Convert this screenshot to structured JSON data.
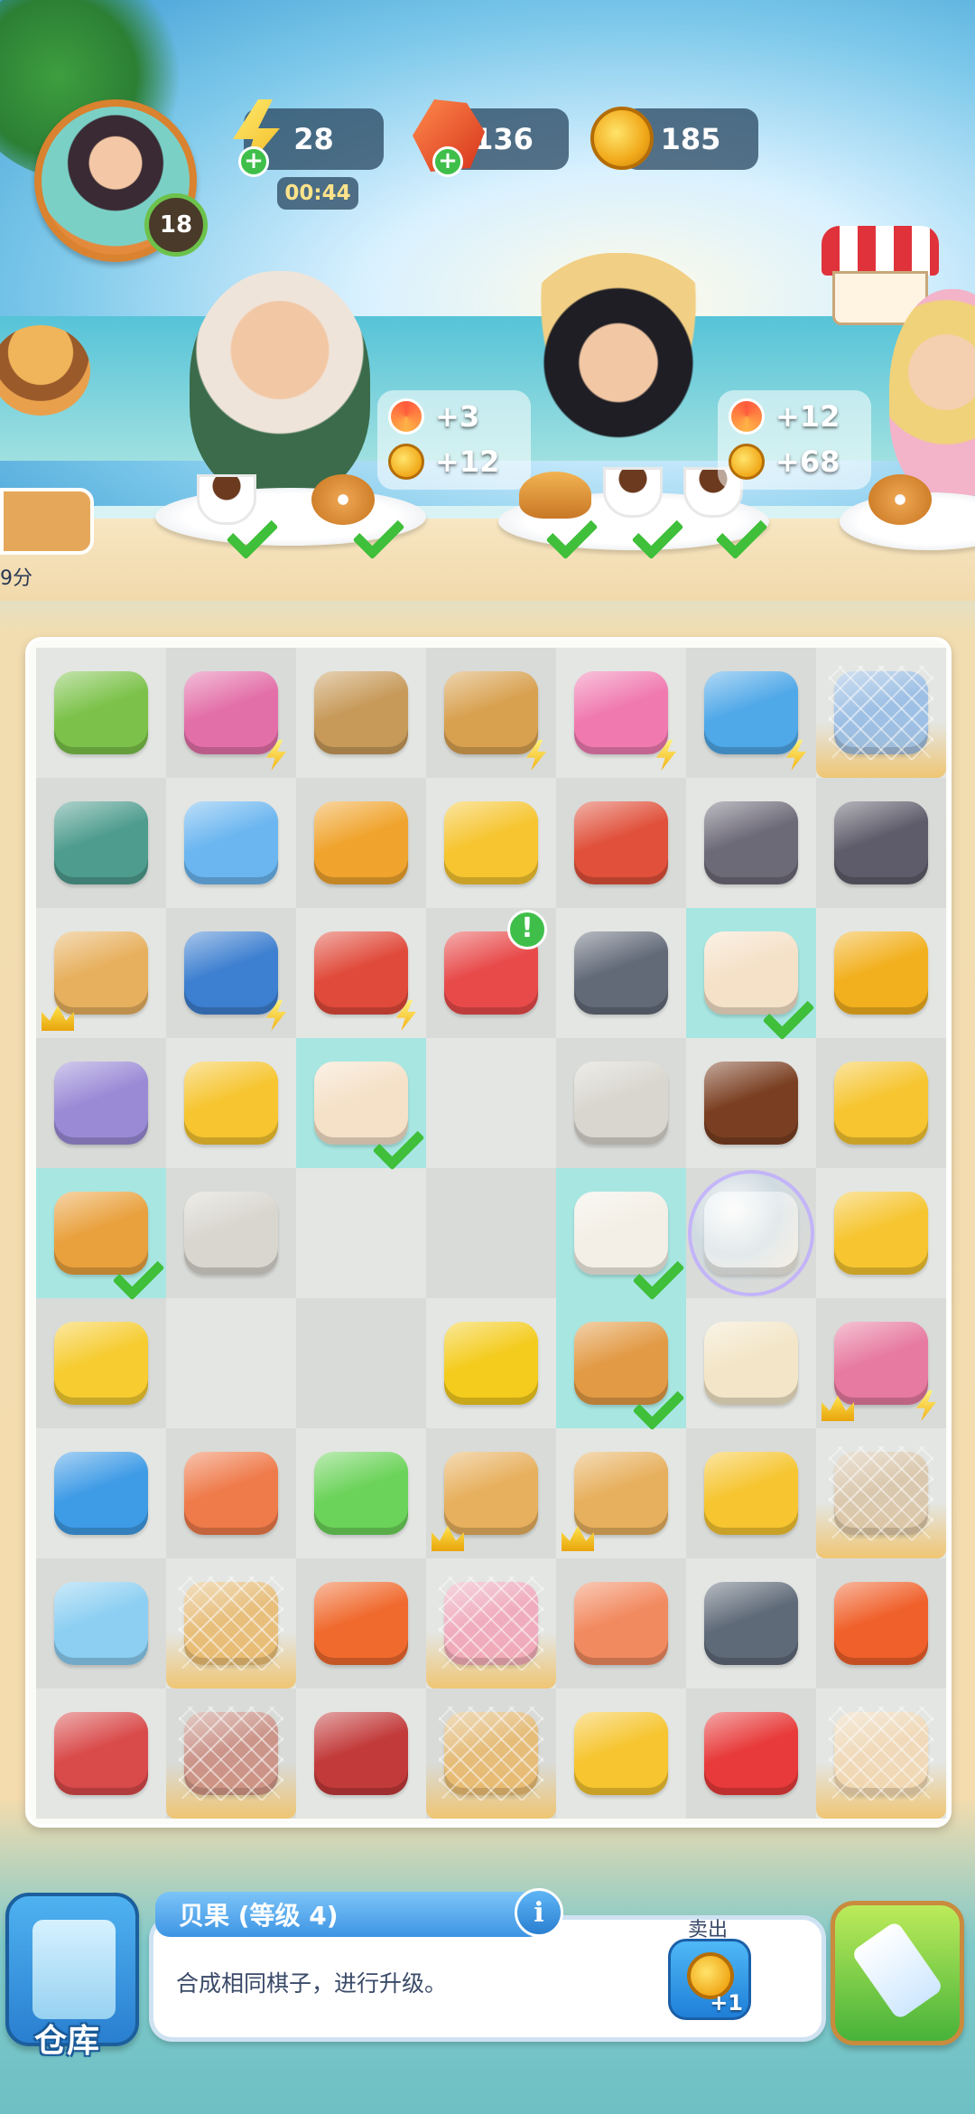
{
  "player": {
    "level": "18"
  },
  "resources": {
    "energy": "28",
    "energy_timer": "00:44",
    "gems": "136",
    "coins": "185"
  },
  "orders": [
    {
      "rewards": {
        "swirl": "+3",
        "coins": "+12"
      }
    },
    {
      "rewards": {
        "swirl": "+12",
        "coins": "+68"
      }
    }
  ],
  "side_timer": "9分",
  "board": {
    "rows": 9,
    "cols": 7,
    "cells": [
      {
        "item": "orange-tree",
        "color": "#7cc24a",
        "badge": "sparkle"
      },
      {
        "item": "claw-machine",
        "color": "#e36fa8",
        "badge": "bolt"
      },
      {
        "item": "grocery-bag",
        "color": "#c79a5a",
        "badge": ""
      },
      {
        "item": "picnic-basket",
        "color": "#d8a150",
        "badge": "bolt"
      },
      {
        "item": "coral-shells",
        "color": "#f07ab0",
        "badge": "bolt"
      },
      {
        "item": "blue-fridge",
        "color": "#4fa8e8",
        "badge": "bolt"
      },
      {
        "item": "milk-carton",
        "color": "#8fb8e6",
        "badge": "web"
      },
      {
        "item": "turtle",
        "color": "#4e9c8e",
        "badge": ""
      },
      {
        "item": "storage-cube",
        "color": "#6bb6f0",
        "badge": ""
      },
      {
        "item": "orange-basket",
        "color": "#f0a42e",
        "badge": ""
      },
      {
        "item": "cheese-piece",
        "color": "#f6c530",
        "badge": ""
      },
      {
        "item": "red-crab",
        "color": "#e0503a",
        "badge": ""
      },
      {
        "item": "rocks-coral",
        "color": "#6d6a78",
        "badge": ""
      },
      {
        "item": "rocks-coral-big",
        "color": "#5e5c6a",
        "badge": ""
      },
      {
        "item": "teapot",
        "color": "#e7b05e",
        "badge": "crown"
      },
      {
        "item": "corn-basket",
        "color": "#3d7fd0",
        "badge": "bolt"
      },
      {
        "item": "coffee-machine",
        "color": "#e04a3a",
        "badge": "bolt"
      },
      {
        "item": "gift-box",
        "color": "#e84a4a",
        "badge": "alert"
      },
      {
        "item": "grey-stones",
        "color": "#626a78",
        "badge": ""
      },
      {
        "item": "coffee-latte",
        "color": "#f5e1c8",
        "badge": "check",
        "highlight": true
      },
      {
        "item": "gold-coins",
        "color": "#f2b01e",
        "badge": ""
      },
      {
        "item": "mystery-box",
        "color": "#9a8ad6",
        "badge": ""
      },
      {
        "item": "cheese-pile",
        "color": "#f6c530",
        "badge": ""
      },
      {
        "item": "coffee-latte",
        "color": "#f5e1c8",
        "badge": "check",
        "highlight": true
      },
      {
        "item": "empty",
        "color": "",
        "badge": ""
      },
      {
        "item": "tea-bag",
        "color": "#d8d6ce",
        "badge": ""
      },
      {
        "item": "chocolate-popsicle",
        "color": "#7a3f22",
        "badge": ""
      },
      {
        "item": "cheese-chunks",
        "color": "#f6c530",
        "badge": ""
      },
      {
        "item": "croissant",
        "color": "#e9a13e",
        "badge": "check",
        "highlight": true
      },
      {
        "item": "tea-bag",
        "color": "#d8d6ce",
        "badge": ""
      },
      {
        "item": "empty",
        "color": "",
        "badge": ""
      },
      {
        "item": "empty",
        "color": "",
        "badge": ""
      },
      {
        "item": "coffee-cup",
        "color": "#f3efe6",
        "badge": "check",
        "highlight": true
      },
      {
        "item": "coffee-cup",
        "color": "#f3efe6",
        "badge": "bubble"
      },
      {
        "item": "cheese-wedges",
        "color": "#f6c530",
        "badge": ""
      },
      {
        "item": "cheese-heap",
        "color": "#f6cc30",
        "badge": ""
      },
      {
        "item": "empty",
        "color": "",
        "badge": ""
      },
      {
        "item": "empty",
        "color": "",
        "badge": ""
      },
      {
        "item": "corn",
        "color": "#f4cc1e",
        "badge": ""
      },
      {
        "item": "bagels",
        "color": "#e29a45",
        "badge": "check",
        "highlight": true
      },
      {
        "item": "ice-cream-cone",
        "color": "#f3e6c8",
        "badge": ""
      },
      {
        "item": "pearl-shell",
        "color": "#e77aa0",
        "badge": "crown-bolt"
      },
      {
        "item": "energy-potion-blue",
        "color": "#3e9be6",
        "badge": ""
      },
      {
        "item": "salmon-plate",
        "color": "#ef7a4a",
        "badge": ""
      },
      {
        "item": "energy-potion-green",
        "color": "#6cd35a",
        "badge": ""
      },
      {
        "item": "teapot",
        "color": "#e7b05e",
        "badge": "crown"
      },
      {
        "item": "teapot",
        "color": "#e7b05e",
        "badge": "crown"
      },
      {
        "item": "mystery-ticket",
        "color": "#f6c530",
        "badge": ""
      },
      {
        "item": "latte-glass",
        "color": "#d9c2a3",
        "badge": "web"
      },
      {
        "item": "ice-cooler",
        "color": "#8ccff2",
        "badge": ""
      },
      {
        "item": "egg-sandwich",
        "color": "#e9b665",
        "badge": "web"
      },
      {
        "item": "orange-gems",
        "color": "#f06a2e",
        "badge": ""
      },
      {
        "item": "sundae",
        "color": "#f3a0b8",
        "badge": "web"
      },
      {
        "item": "salmon-fillet",
        "color": "#f28a60",
        "badge": ""
      },
      {
        "item": "spatula",
        "color": "#5f6a78",
        "badge": ""
      },
      {
        "item": "orange-gems-big",
        "color": "#f0602a",
        "badge": ""
      },
      {
        "item": "pot",
        "color": "#d94a4a",
        "badge": ""
      },
      {
        "item": "ice-cream-cup",
        "color": "#c9867a",
        "badge": "web"
      },
      {
        "item": "frying-pan",
        "color": "#c23a3a",
        "badge": ""
      },
      {
        "item": "sandwich",
        "color": "#e9b665",
        "badge": "web"
      },
      {
        "item": "toy-rake",
        "color": "#f6c530",
        "badge": ""
      },
      {
        "item": "toy-shovel",
        "color": "#e83a3a",
        "badge": ""
      },
      {
        "item": "cake-roll",
        "color": "#f3d7b0",
        "badge": "web"
      }
    ]
  },
  "info_panel": {
    "title": "贝果 (等级 4)",
    "info_icon": "i",
    "description": "合成相同棋子，进行升级。",
    "sell_label": "卖出",
    "sell_amount": "+1"
  },
  "storage_label": "仓库",
  "icons": {
    "energy": "lightning-icon",
    "gems": "gem-icon",
    "coins": "coin-icon",
    "brush": "brush-icon"
  },
  "colors": {
    "accent_blue": "#3e95e4",
    "check_green": "#3fbf3a",
    "highlight_cell": "#a8e6e2",
    "panel_bg": "#ffffff"
  }
}
